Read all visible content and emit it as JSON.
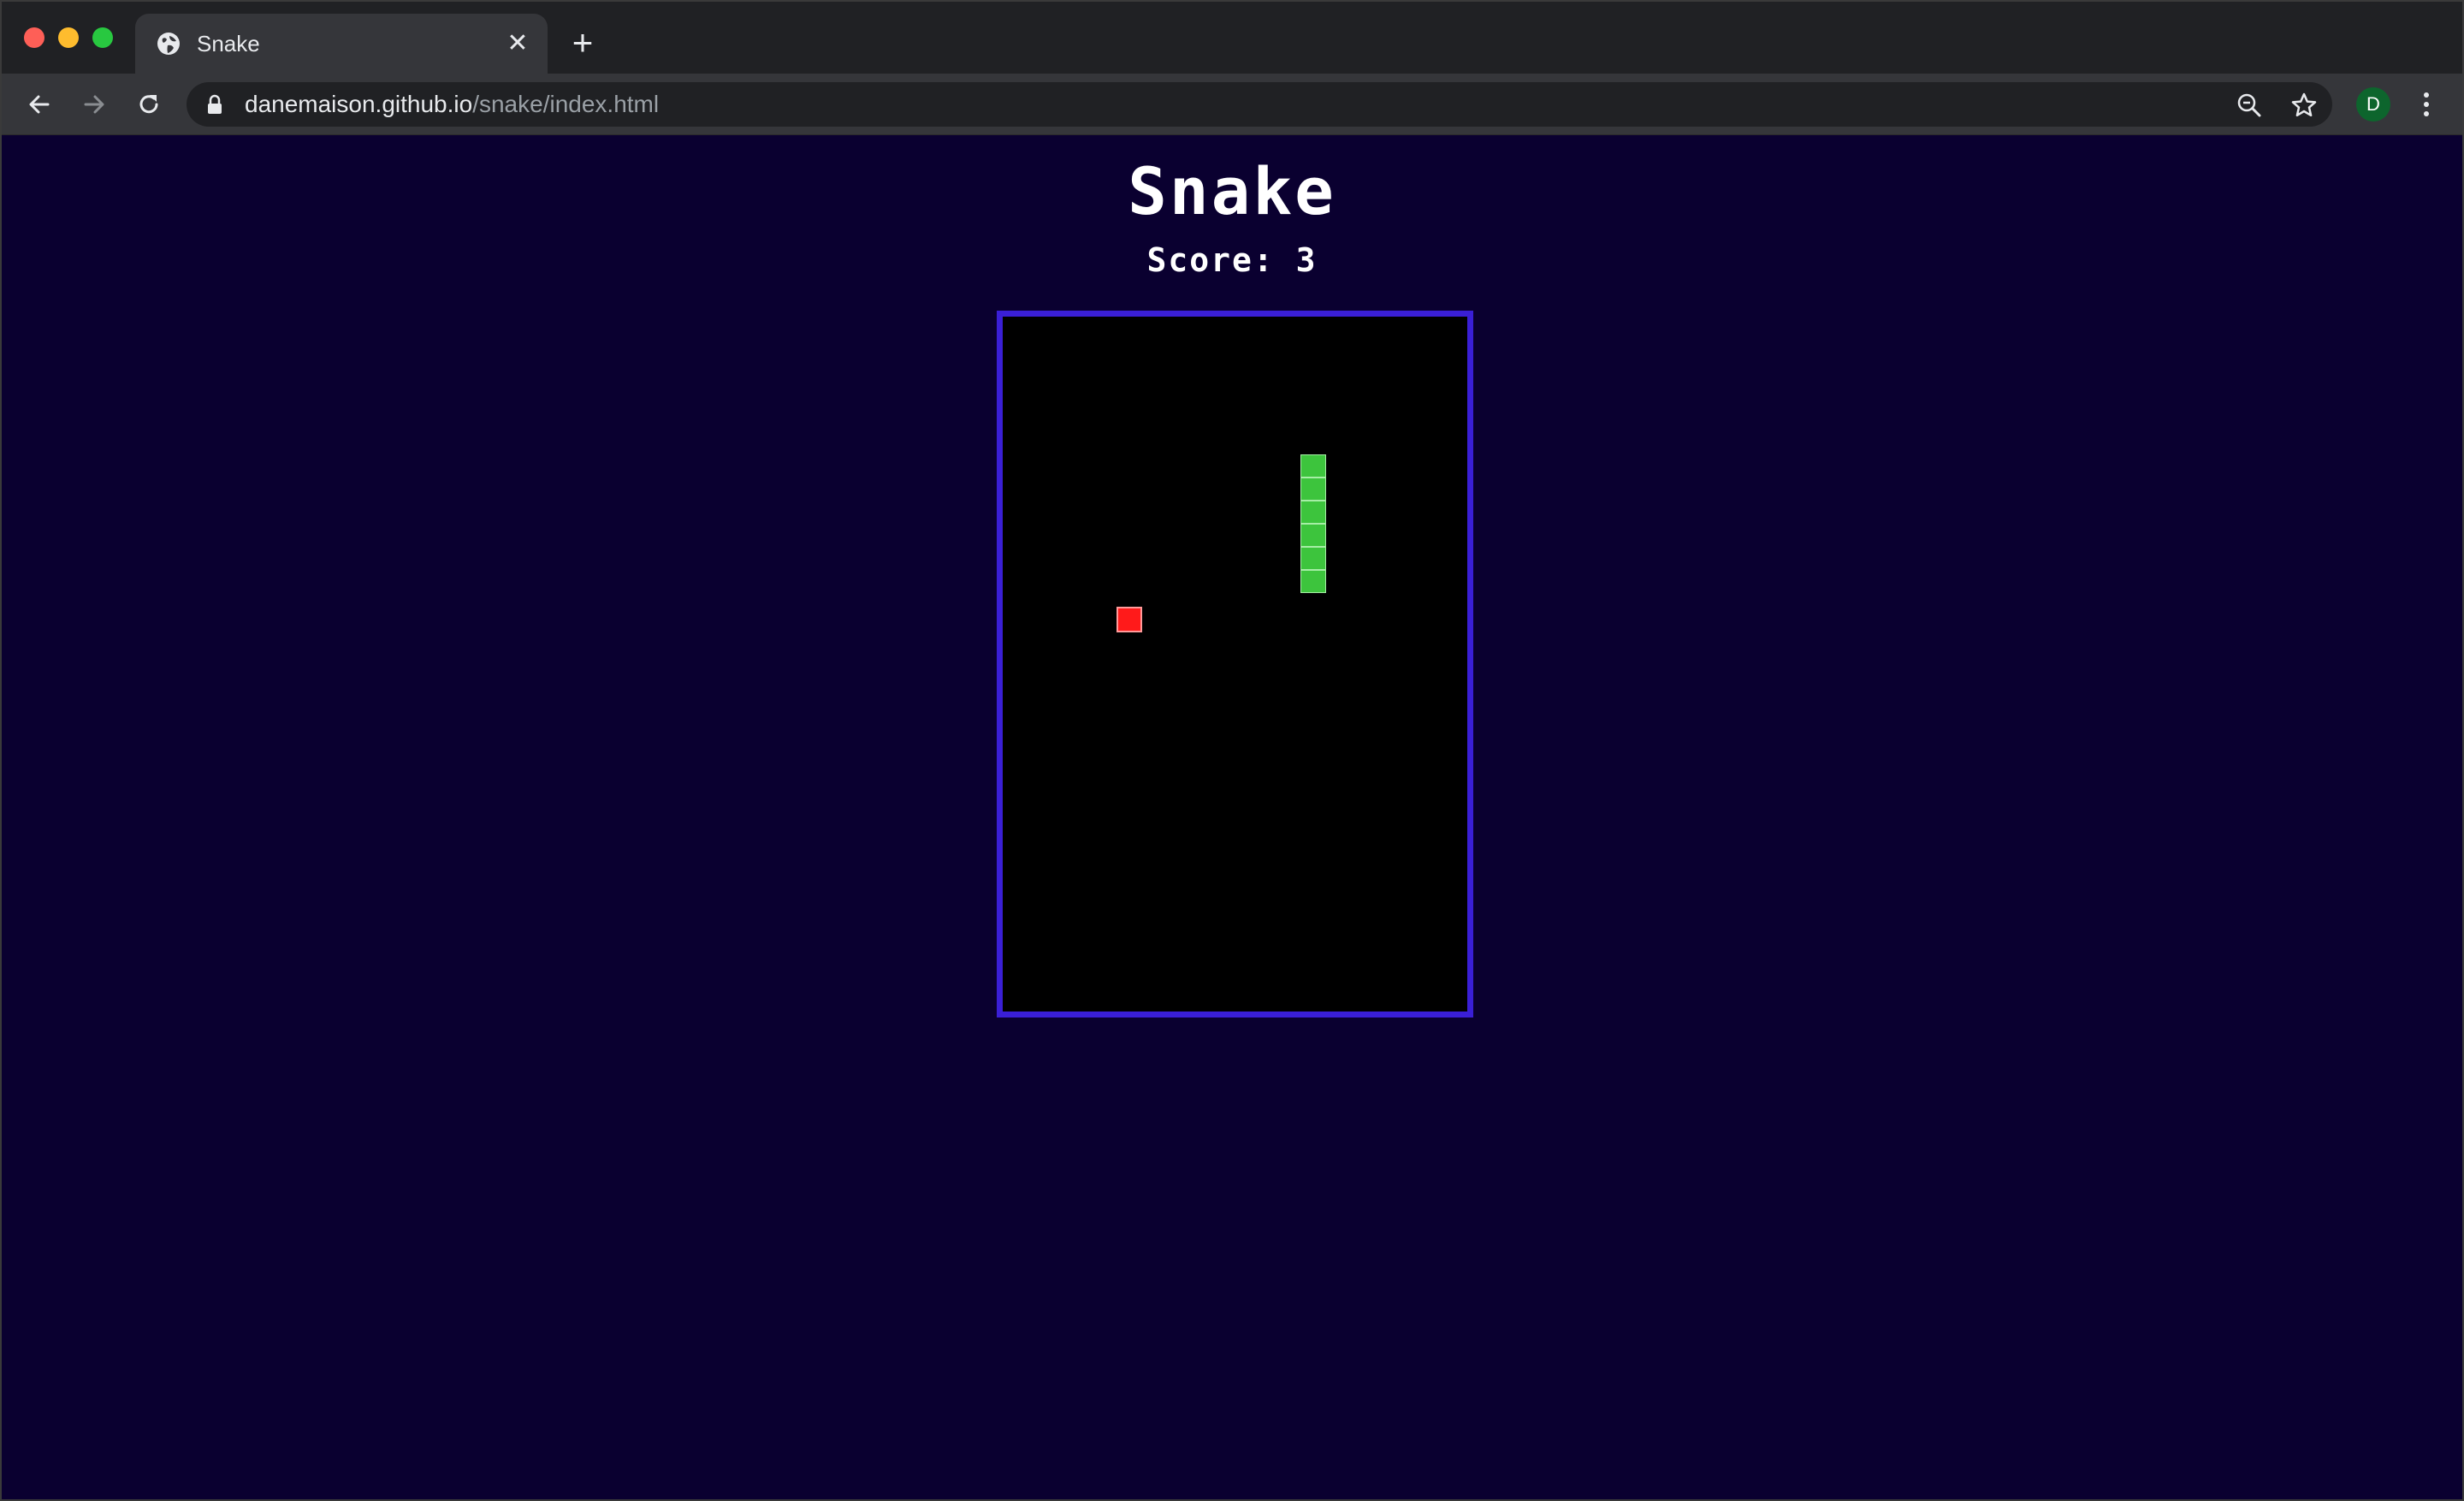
{
  "browser": {
    "tab": {
      "title": "Snake",
      "close_label": "✕",
      "favicon": "globe-icon"
    },
    "new_tab_label": "+",
    "url": {
      "host": "danemaison.github.io",
      "path": "/snake/index.html"
    },
    "profile_initial": "D",
    "icons": [
      "back-arrow-icon",
      "forward-arrow-icon",
      "reload-icon",
      "lock-icon",
      "zoom-icon",
      "star-icon",
      "kebab-menu-icon"
    ]
  },
  "game": {
    "title": "Snake",
    "score_label": "Score:",
    "score": "3",
    "colors": {
      "page_background": "#0a0030",
      "board_border": "#3a1fd6",
      "board_background": "#000000",
      "snake": "#3dc43d",
      "food": "#ff1a1a"
    },
    "snake_length": 6
  }
}
